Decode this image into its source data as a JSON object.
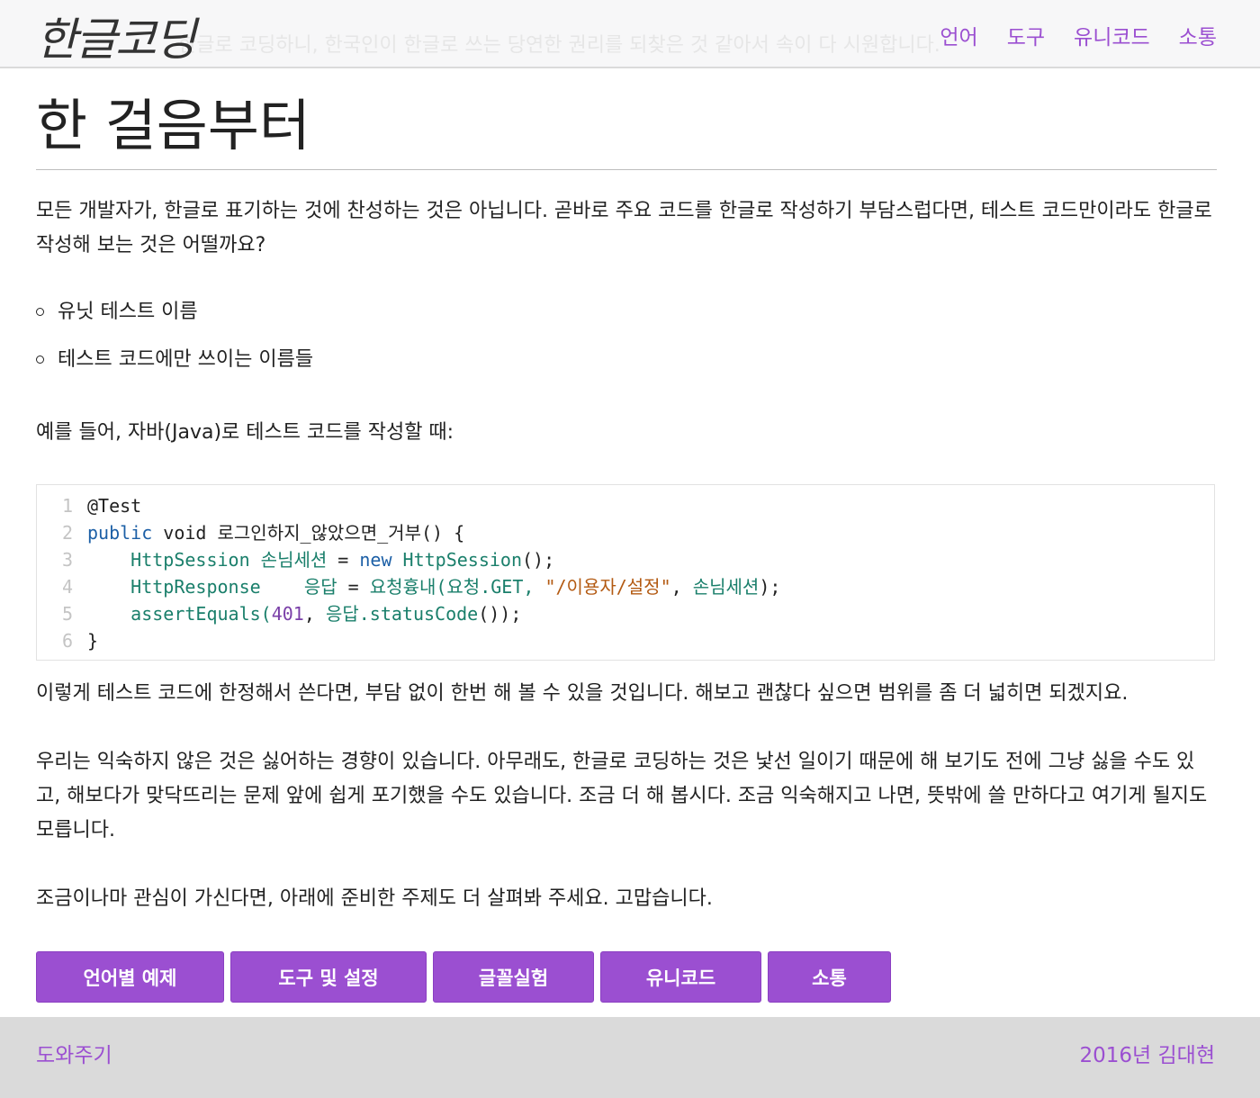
{
  "header": {
    "logo": "한글코딩",
    "tagline": "한글로 코딩하니, 한국인이 한글로 쓰는 당연한 권리를 되찾은 것 같아서 속이 다 시원합니다.",
    "nav": [
      "언어",
      "도구",
      "유니코드",
      "소통"
    ]
  },
  "main": {
    "title": "한 걸음부터",
    "intro": "모든 개발자가, 한글로 표기하는 것에 찬성하는 것은 아닙니다. 곧바로 주요 코드를 한글로 작성하기 부담스럽다면, 테스트 코드만이라도 한글로 작성해 보는 것은 어떨까요?",
    "bullets": [
      "유닛 테스트 이름",
      "테스트 코드에만 쓰이는 이름들"
    ],
    "example_intro": "예를 들어, 자바(Java)로 테스트 코드를 작성할 때:",
    "code": {
      "line_numbers": [
        "1",
        "2",
        "3",
        "4",
        "5",
        "6"
      ],
      "l1": "@Test",
      "l2_kw": "public",
      "l2_rest": " void 로그인하지_않았으면_거부() {",
      "l3_type": "HttpSession 손님세션",
      "l3_eq": " = ",
      "l3_new": "new",
      "l3_ctor": " HttpSession",
      "l3_end": "();",
      "l4_type": "HttpResponse    응답",
      "l4_eq": " = ",
      "l4_call": "요청흉내(요청.GET, ",
      "l4_str": "\"/이용자/설정\"",
      "l4_sep": ", ",
      "l4_arg": "손님세션",
      "l4_end": ");",
      "l5_call": "assertEquals(",
      "l5_num": "401",
      "l5_sep": ", ",
      "l5_arg": "응답.statusCode",
      "l5_end": "());",
      "l6": "}"
    },
    "after_code": "이렇게 테스트 코드에 한정해서 쓴다면, 부담 없이 한번 해 볼 수 있을 것입니다. 해보고 괜찮다 싶으면 범위를 좀 더 넓히면 되겠지요.",
    "encourage": "우리는 익숙하지 않은 것은 싫어하는 경향이 있습니다. 아무래도, 한글로 코딩하는 것은 낯선 일이기 때문에 해 보기도 전에 그냥 싫을 수도 있고, 해보다가 맞닥뜨리는 문제 앞에 쉽게 포기했을 수도 있습니다. 조금 더 해 봅시다. 조금 익숙해지고 나면, 뜻밖에 쓸 만하다고 여기게 될지도 모릅니다.",
    "closing": "조금이나마 관심이 가신다면, 아래에 준비한 주제도 더 살펴봐 주세요. 고맙습니다.",
    "buttons": [
      "언어별 예제",
      "도구 및 설정",
      "글꼴실험",
      "유니코드",
      "소통"
    ]
  },
  "footer": {
    "help": "도와주기",
    "copyright": "2016년 김대현"
  },
  "colors": {
    "accent": "#9b4fd1",
    "footer_bg": "#dadada",
    "keyword": "#1c5fa6",
    "type": "#1a7f6b",
    "string": "#b35a12"
  }
}
